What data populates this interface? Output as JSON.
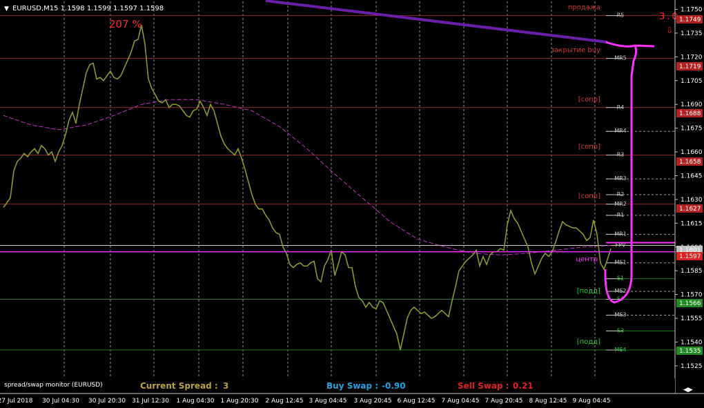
{
  "header": {
    "symbol_info": "EURUSD,M15  1.1598 1.1599 1.1597 1.1598"
  },
  "colors": {
    "background": "#000000",
    "price": "#8a9a2a",
    "ma": "#c033c0",
    "trend": "#6a1fa8",
    "magenta": "#ff33ff",
    "red_line": "#8c2b2b",
    "green_line": "#1f7a1f",
    "grid": "#c8c8c8"
  },
  "annotations": {
    "percent": "207 %",
    "counter": "3.0",
    "sell": "продажа",
    "close_buy": "закрытие buy",
    "center": "центр"
  },
  "chart_data": {
    "type": "line",
    "symbol": "EURUSD",
    "timeframe": "M15",
    "ylim": [
      1.1518,
      1.1755
    ],
    "y_ticks": [
      1.1525,
      1.154,
      1.1555,
      1.157,
      1.1585,
      1.16,
      1.1615,
      1.163,
      1.1645,
      1.166,
      1.1675,
      1.169,
      1.1705,
      1.172,
      1.1735,
      1.175
    ],
    "x_ticks": [
      "27 Jul 2018",
      "30 Jul 04:30",
      "30 Jul 20:30",
      "31 Jul 12:30",
      "1 Aug 04:30",
      "1 Aug 20:30",
      "2 Aug 12:45",
      "3 Aug 04:45",
      "3 Aug 20:45",
      "6 Aug 12:45",
      "7 Aug 04:45",
      "7 Aug 20:45",
      "8 Aug 12:45",
      "9 Aug 04:45"
    ],
    "series": [
      {
        "x": [
          0,
          5,
          10,
          15,
          20,
          25,
          30,
          35,
          40,
          45,
          50,
          55,
          60,
          65,
          70,
          75,
          80,
          85,
          90,
          95,
          100,
          105,
          110,
          115,
          120,
          125,
          130,
          135,
          140,
          145,
          150,
          155,
          160,
          165,
          170,
          175,
          180,
          185,
          190,
          195,
          200,
          205,
          210,
          215,
          220,
          225,
          230,
          235,
          240,
          245,
          250,
          255,
          260,
          265,
          270,
          275,
          280,
          285,
          290,
          295,
          300,
          305,
          310,
          315,
          320,
          325,
          330,
          335,
          340,
          345,
          350,
          355,
          360,
          365,
          370,
          375,
          380,
          385,
          390,
          395,
          400,
          405,
          410,
          415,
          420,
          425,
          430,
          435,
          440,
          445,
          450,
          455,
          460,
          465,
          470,
          475,
          480,
          485,
          490,
          495,
          500,
          505,
          510,
          515,
          520,
          525,
          530,
          535,
          540,
          545,
          550,
          555,
          560,
          565,
          570,
          575,
          580,
          585,
          590,
          595,
          600,
          605,
          610,
          615,
          620,
          625,
          630,
          635,
          640,
          645,
          650,
          655,
          660,
          665,
          670,
          675,
          680,
          685,
          690,
          695,
          700,
          705,
          710,
          715,
          720,
          725,
          730,
          735,
          740,
          745,
          750,
          755,
          760,
          765,
          770,
          775,
          780,
          785,
          790,
          795,
          800,
          805,
          810,
          815,
          820,
          825,
          830,
          835,
          840,
          845,
          850,
          855,
          860,
          865,
          870,
          875,
          880
        ],
        "values": [
          1.1625,
          1.1628,
          1.1631,
          1.1648,
          1.1654,
          1.1656,
          1.1659,
          1.1657,
          1.166,
          1.1662,
          1.1659,
          1.1664,
          1.1662,
          1.1658,
          1.166,
          1.1654,
          1.166,
          1.1664,
          1.1671,
          1.168,
          1.1685,
          1.1678,
          1.169,
          1.17,
          1.171,
          1.1715,
          1.1716,
          1.1706,
          1.1707,
          1.1705,
          1.1708,
          1.1711,
          1.1707,
          1.1706,
          1.1708,
          1.1713,
          1.1718,
          1.1723,
          1.173,
          1.1731,
          1.174,
          1.1728,
          1.1706,
          1.17,
          1.1696,
          1.1692,
          1.1691,
          1.1693,
          1.1688,
          1.169,
          1.169,
          1.1689,
          1.1686,
          1.1683,
          1.1682,
          1.1686,
          1.1687,
          1.1692,
          1.1688,
          1.1683,
          1.169,
          1.1686,
          1.1678,
          1.167,
          1.1665,
          1.1662,
          1.166,
          1.1658,
          1.1662,
          1.1656,
          1.1649,
          1.1641,
          1.1633,
          1.1627,
          1.1624,
          1.1624,
          1.162,
          1.1617,
          1.1612,
          1.1609,
          1.1608,
          1.16,
          1.1596,
          1.1589,
          1.1587,
          1.1589,
          1.159,
          1.1588,
          1.1588,
          1.159,
          1.1591,
          1.158,
          1.1578,
          1.1588,
          1.1592,
          1.1598,
          1.1582,
          1.1589,
          1.1597,
          1.1595,
          1.1587,
          1.1587,
          1.1575,
          1.1568,
          1.1566,
          1.1562,
          1.1565,
          1.1562,
          1.1561,
          1.1566,
          1.1565,
          1.156,
          1.1555,
          1.155,
          1.1545,
          1.1535,
          1.1545,
          1.1555,
          1.156,
          1.1562,
          1.156,
          1.1558,
          1.1559,
          1.1557,
          1.1555,
          1.1556,
          1.1558,
          1.156,
          1.1558,
          1.1556,
          1.1566,
          1.1575,
          1.1585,
          1.1588,
          1.1591,
          1.1593,
          1.1595,
          1.1598,
          1.1588,
          1.1594,
          1.1589,
          1.1595,
          1.1597,
          1.1597,
          1.1599,
          1.1598,
          1.1614,
          1.1623,
          1.1618,
          1.1615,
          1.161,
          1.1605,
          1.16,
          1.159,
          1.1583,
          1.1588,
          1.1593,
          1.1596,
          1.1594,
          1.1597,
          1.1603,
          1.161,
          1.1616,
          1.1614,
          1.1613,
          1.1612,
          1.1612,
          1.161,
          1.1608,
          1.1604,
          1.1606,
          1.1617,
          1.1608,
          1.159,
          1.1586,
          1.1592,
          1.1599
        ]
      },
      {
        "x": [
          0,
          40,
          80,
          120,
          160,
          200,
          240,
          280,
          320,
          360,
          400,
          440,
          480,
          520,
          560,
          600,
          640,
          680,
          720,
          760,
          800,
          840,
          880
        ],
        "values": [
          1.1683,
          1.1677,
          1.1674,
          1.1677,
          1.1683,
          1.169,
          1.1693,
          1.1693,
          1.169,
          1.1686,
          1.1676,
          1.1662,
          1.1646,
          1.1631,
          1.1616,
          1.1605,
          1.16,
          1.1596,
          1.1595,
          1.1596,
          1.1598,
          1.16,
          1.1601
        ]
      }
    ],
    "levels": [
      {
        "label": "R5",
        "price": 1.1746,
        "kind": "red",
        "text": "продажа"
      },
      {
        "label": "MR5",
        "price": 1.1719,
        "kind": "red",
        "text": "закрытие buy"
      },
      {
        "label": "R4",
        "price": 1.1688,
        "kind": "red",
        "text": "[сопр]"
      },
      {
        "label": "MR4",
        "price": 1.1673,
        "kind": "dashed"
      },
      {
        "label": "R3",
        "price": 1.1658,
        "kind": "red",
        "text": "[сопр]"
      },
      {
        "label": "MR3",
        "price": 1.1643,
        "kind": "dashed"
      },
      {
        "label": "R2",
        "price": 1.1633,
        "kind": "dashed"
      },
      {
        "label": "MR2",
        "price": 1.1627,
        "kind": "red",
        "text": "[сопр]"
      },
      {
        "label": "R1",
        "price": 1.162,
        "kind": "dashed"
      },
      {
        "label": "MR1",
        "price": 1.1608,
        "kind": "dashed"
      },
      {
        "label": "FPV",
        "price": 1.1601,
        "kind": "white"
      },
      {
        "label": "MS1",
        "price": 1.159,
        "kind": "dashed",
        "text": "центр"
      },
      {
        "label": "S1",
        "price": 1.158,
        "kind": "green_short"
      },
      {
        "label": "MS2",
        "price": 1.1572,
        "kind": "dashed"
      },
      {
        "label": "S2",
        "price": 1.1567,
        "kind": "green",
        "text": "[подд]"
      },
      {
        "label": "MS3",
        "price": 1.1557,
        "kind": "dashed"
      },
      {
        "label": "S3",
        "price": 1.1547,
        "kind": "green_short"
      },
      {
        "label": "MS4",
        "price": 1.1535,
        "kind": "green",
        "text": "[подд]"
      }
    ],
    "price_labels": [
      {
        "value": "1.1749",
        "color": "#b22222"
      },
      {
        "value": "1.1719",
        "color": "#b22222"
      },
      {
        "value": "1.1688",
        "color": "#b22222"
      },
      {
        "value": "1.1658",
        "color": "#b22222"
      },
      {
        "value": "1.1627",
        "color": "#b22222"
      },
      {
        "value": "1.1601",
        "color": "#c0c0c0"
      },
      {
        "value": "1.1597",
        "color": "#dd2222"
      },
      {
        "value": "1.1566",
        "color": "#228b22"
      },
      {
        "value": "1.1535",
        "color": "#228b22"
      }
    ]
  },
  "spread_monitor": {
    "title": "spread/swap monitor (EURUSD)",
    "spread_label": "Current Spread :",
    "spread_value": "3",
    "buy_swap_label": "Buy Swap :",
    "buy_swap_value": "-0.90",
    "sell_swap_label": "Sell Swap :",
    "sell_swap_value": "0.21"
  }
}
